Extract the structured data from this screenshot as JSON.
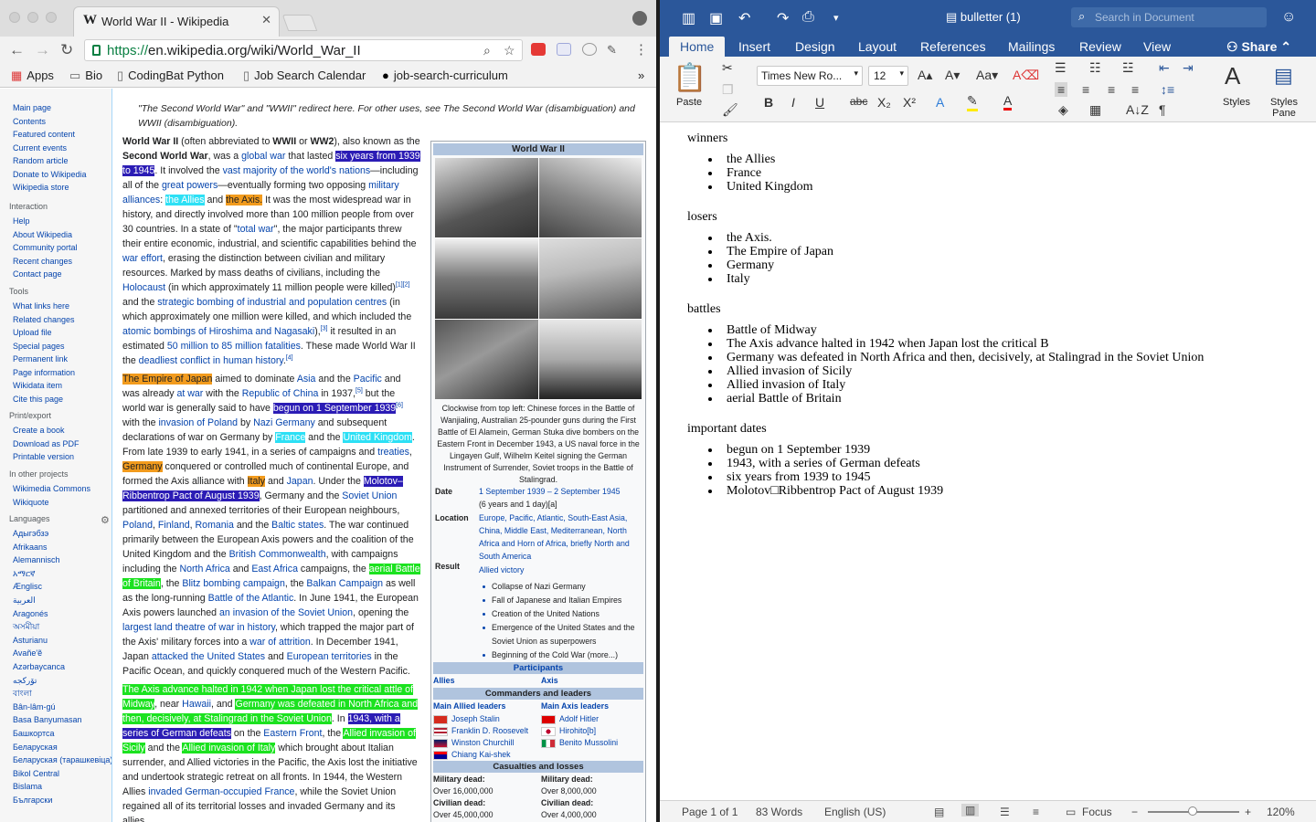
{
  "browser": {
    "tab_title": "World War II - Wikipedia",
    "tab_favicon": "W",
    "url_scheme": "https://",
    "url_rest": "en.wikipedia.org/wiki/World_War_II",
    "bookmarks": [
      {
        "label": "Apps",
        "icon": "apps-grid-icon"
      },
      {
        "label": "Bio",
        "icon": "folder-icon"
      },
      {
        "label": "CodingBat Python",
        "icon": "page-icon"
      },
      {
        "label": "Job Search Calendar",
        "icon": "page-icon"
      },
      {
        "label": "job-search-curriculum",
        "icon": "github-icon"
      }
    ],
    "overflow": "»"
  },
  "wiki": {
    "sidebar": {
      "main": [
        "Main page",
        "Contents",
        "Featured content",
        "Current events",
        "Random article",
        "Donate to Wikipedia",
        "Wikipedia store"
      ],
      "interaction_heading": "Interaction",
      "interaction": [
        "Help",
        "About Wikipedia",
        "Community portal",
        "Recent changes",
        "Contact page"
      ],
      "tools_heading": "Tools",
      "tools": [
        "What links here",
        "Related changes",
        "Upload file",
        "Special pages",
        "Permanent link",
        "Page information",
        "Wikidata item",
        "Cite this page"
      ],
      "print_heading": "Print/export",
      "print": [
        "Create a book",
        "Download as PDF",
        "Printable version"
      ],
      "projects_heading": "In other projects",
      "projects": [
        "Wikimedia Commons",
        "Wikiquote"
      ],
      "languages_heading": "Languages",
      "languages": [
        "Адыгэбзэ",
        "Afrikaans",
        "Alemannisch",
        "አማርኛ",
        "Ænglisc",
        "العربية",
        "Aragonés",
        "অসমীয়া",
        "Asturianu",
        "Avañe'ẽ",
        "Azərbaycanca",
        "تۆرکجه",
        "বাংলা",
        "Bân-lâm-gú",
        "Basa Banyumasan",
        "Башкортса",
        "Беларуская",
        "Беларуская (тарашкевіца)",
        "Bikol Central",
        "Bislama",
        "Български"
      ]
    },
    "hatnote": "\"The Second World War\" and \"WWII\" redirect here. For other uses, see The Second World War (disambiguation) and WWII (disambiguation).",
    "infobox": {
      "title": "World War II",
      "caption": "Clockwise from top left: Chinese forces in the Battle of Wanjialing, Australian 25-pounder guns during the First Battle of El Alamein, German Stuka dive bombers on the Eastern Front in December 1943, a US naval force in the Lingayen Gulf, Wilhelm Keitel signing the German Instrument of Surrender, Soviet troops in the Battle of Stalingrad.",
      "date_label": "Date",
      "date_value": "1 September 1939 – 2 September 1945",
      "date_note": "(6 years and 1 day)[a]",
      "location_label": "Location",
      "location_value": "Europe, Pacific, Atlantic, South-East Asia, China, Middle East, Mediterranean, North Africa and Horn of Africa, briefly North and South America",
      "result_label": "Result",
      "result_value": "Allied victory",
      "result_items": [
        "Collapse of Nazi Germany",
        "Fall of Japanese and Italian Empires",
        "Creation of the United Nations",
        "Emergence of the United States and the Soviet Union as superpowers",
        "Beginning of the Cold War (more...)"
      ],
      "participants_band": "Participants",
      "allies": "Allies",
      "axis": "Axis",
      "commanders_band": "Commanders and leaders",
      "allied_leaders_label": "Main Allied leaders",
      "axis_leaders_label": "Main Axis leaders",
      "allied_leaders": [
        "Joseph Stalin",
        "Franklin D. Roosevelt",
        "Winston Churchill",
        "Chiang Kai-shek"
      ],
      "axis_leaders": [
        "Adolf Hitler",
        "Hirohito[b]",
        "Benito Mussolini"
      ],
      "casualties_band": "Casualties and losses",
      "allied_mil_label": "Military dead:",
      "allied_mil": "Over 16,000,000",
      "allied_civ_label": "Civilian dead:",
      "allied_civ": "Over 45,000,000",
      "axis_mil_label": "Military dead:",
      "axis_mil": "Over 8,000,000",
      "axis_civ_label": "Civilian dead:",
      "axis_civ": "Over 4,000,000"
    }
  },
  "word": {
    "doc_title": "bulletter (1)",
    "search_placeholder": "Search in Document",
    "tabs": [
      "Home",
      "Insert",
      "Design",
      "Layout",
      "References",
      "Mailings",
      "Review",
      "View"
    ],
    "share": "Share",
    "paste_label": "Paste",
    "font_name": "Times New Ro...",
    "font_size": "12",
    "styles_label": "Styles",
    "styles_pane_label": "Styles Pane",
    "sections": [
      {
        "heading": "winners",
        "items": [
          "the Allies",
          "France",
          "United Kingdom"
        ]
      },
      {
        "heading": "losers",
        "items": [
          "the Axis.",
          "The Empire of Japan",
          "Germany",
          "Italy"
        ]
      },
      {
        "heading": "battles",
        "items": [
          "Battle of Midway",
          "The Axis advance halted in 1942 when Japan lost the critical B",
          "Germany was defeated in North Africa and then, decisively, at Stalingrad in the Soviet Union",
          "Allied invasion of Sicily",
          "Allied invasion of Italy",
          "aerial Battle of Britain"
        ]
      },
      {
        "heading": "important dates",
        "items": [
          "begun on 1 September 1939",
          "1943, with a series of German defeats",
          "six years from 1939 to 1945",
          "Molotov□Ribbentrop Pact of August 1939"
        ]
      }
    ],
    "status": {
      "page": "Page 1 of 1",
      "words": "83 Words",
      "language": "English (US)",
      "focus": "Focus",
      "zoom": "120%"
    }
  }
}
